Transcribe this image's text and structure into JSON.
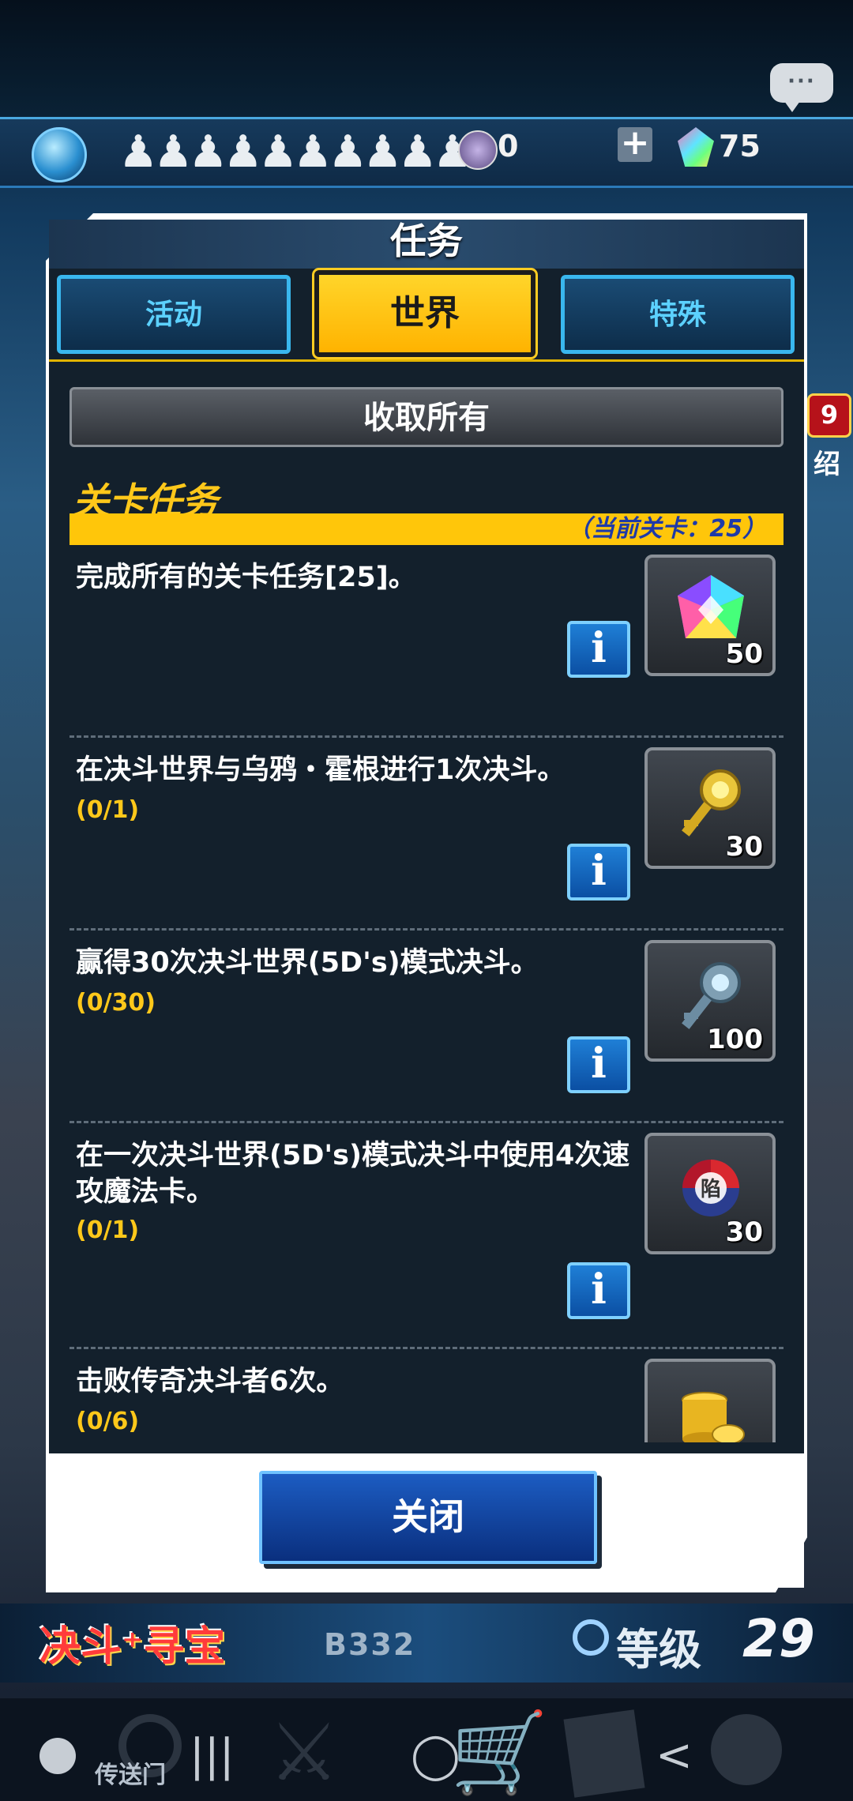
{
  "background": {
    "chat_icon": "speech-bubble-icon",
    "currency_dark": "0",
    "currency_gems": "75",
    "side_badge": "9",
    "side_text": "绍",
    "banner_logo": "决斗⁺寻宝",
    "floor_code": "B332",
    "level_label": "等级",
    "level_value": "29",
    "portal_label": "传送门"
  },
  "system_nav": {
    "recents": "|||",
    "home": "◯",
    "back": "<"
  },
  "modal": {
    "title": "任务",
    "tabs": [
      {
        "label": "活动",
        "active": false
      },
      {
        "label": "世界",
        "active": true
      },
      {
        "label": "特殊",
        "active": false
      }
    ],
    "collect_all_label": "收取所有",
    "section_title": "关卡任务",
    "section_current": "（当前关卡：25）",
    "info_label": "i",
    "missions": [
      {
        "desc": "完成所有的关卡任务[25]。",
        "progress": "",
        "reward_icon": "rainbow-gem-icon",
        "reward_count": "50"
      },
      {
        "desc": "在决斗世界与乌鸦・霍根进行1次决斗。",
        "progress": "(0/1)",
        "reward_icon": "gold-key-icon",
        "reward_count": "30"
      },
      {
        "desc": "赢得30次决斗世界(5D's)模式决斗。",
        "progress": "(0/30)",
        "reward_icon": "silver-key-icon",
        "reward_count": "100"
      },
      {
        "desc": "在一次决斗世界(5D's)模式决斗中使用4次速攻魔法卡。",
        "progress": "(0/1)",
        "reward_icon": "trap-orb-icon",
        "reward_count": "30"
      },
      {
        "desc": "击败传奇决斗者6次。",
        "progress": "(0/6)",
        "reward_icon": "gold-coins-icon",
        "reward_count": ""
      }
    ],
    "close_label": "关闭"
  }
}
